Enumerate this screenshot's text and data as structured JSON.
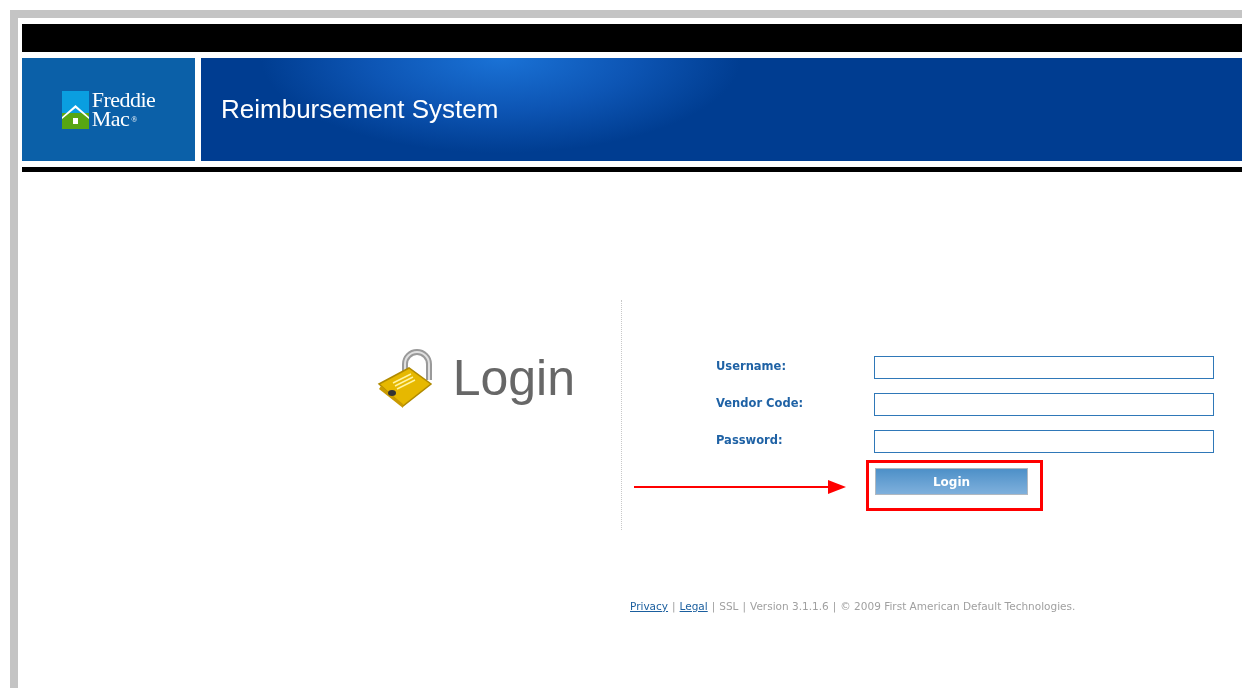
{
  "header": {
    "logo": {
      "line_1": "Freddie",
      "line_2": "Mac",
      "mark": "®"
    },
    "title": "Reimbursement System"
  },
  "login": {
    "heading": "Login"
  },
  "form": {
    "fields": [
      {
        "label": "Username:"
      },
      {
        "label": "Vendor Code:"
      },
      {
        "label": "Password:"
      }
    ],
    "button": "Login"
  },
  "annotations": {
    "arrow": true,
    "highlight": true
  },
  "footer": [
    {
      "kind": "link",
      "text": "Privacy"
    },
    {
      "kind": "separator",
      "text": "|"
    },
    {
      "kind": "link",
      "text": "Legal"
    },
    {
      "kind": "separator",
      "text": "|"
    },
    {
      "kind": "text",
      "text": "SSL"
    },
    {
      "kind": "separator",
      "text": "|"
    },
    {
      "kind": "text",
      "text": "Version 3.1.1.6"
    },
    {
      "kind": "separator",
      "text": "|"
    },
    {
      "kind": "text",
      "text": "© 2009 First American Default Technologies."
    }
  ]
}
